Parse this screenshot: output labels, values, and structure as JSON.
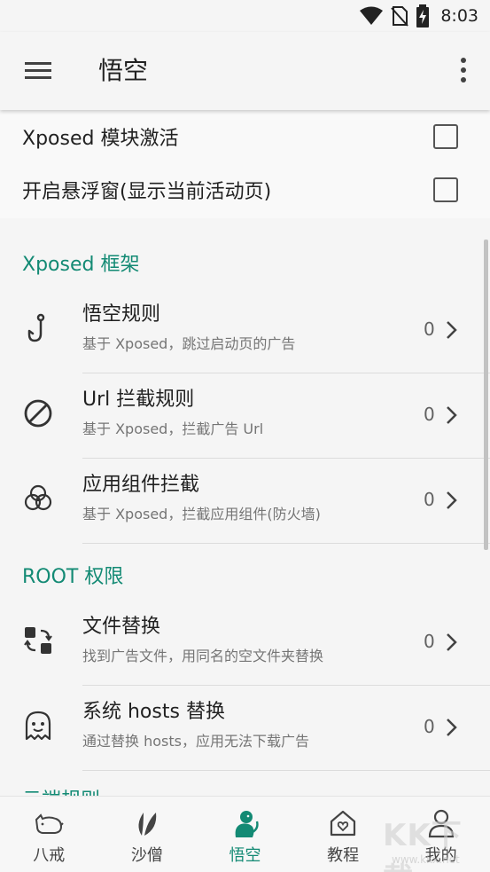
{
  "status_bar": {
    "time": "8:03"
  },
  "app_bar": {
    "title": "悟空"
  },
  "settings": [
    {
      "label": "Xposed 模块激活",
      "checked": false
    },
    {
      "label": "开启悬浮窗(显示当前活动页)",
      "checked": false
    }
  ],
  "sections": [
    {
      "header": "Xposed 框架",
      "items": [
        {
          "title": "悟空规则",
          "subtitle": "基于 Xposed，跳过启动页的广告",
          "count": "0",
          "icon": "hook-icon"
        },
        {
          "title": "Url 拦截规则",
          "subtitle": "基于 Xposed，拦截广告 Url",
          "count": "0",
          "icon": "block-icon"
        },
        {
          "title": "应用组件拦截",
          "subtitle": "基于 Xposed，拦截应用组件(防火墙)",
          "count": "0",
          "icon": "components-icon"
        }
      ]
    },
    {
      "header": "ROOT 权限",
      "items": [
        {
          "title": "文件替换",
          "subtitle": "找到广告文件，用同名的空文件夹替换",
          "count": "0",
          "icon": "file-swap-icon"
        },
        {
          "title": "系统 hosts 替换",
          "subtitle": "通过替换 hosts，应用无法下载广告",
          "count": "0",
          "icon": "ghost-icon"
        }
      ]
    },
    {
      "header": "云端规则"
    }
  ],
  "bottom_nav": [
    {
      "label": "八戒",
      "icon": "pig-icon",
      "active": false
    },
    {
      "label": "沙僧",
      "icon": "leaf-icon",
      "active": false
    },
    {
      "label": "悟空",
      "icon": "monkey-icon",
      "active": true
    },
    {
      "label": "教程",
      "icon": "home-heart-icon",
      "active": false
    },
    {
      "label": "我的",
      "icon": "person-icon",
      "active": false
    }
  ],
  "watermark": {
    "text": "KK下载",
    "url": "www.kkx.net"
  },
  "colors": {
    "accent": "#138a74",
    "background": "#f5f5f5",
    "text_primary": "#212121",
    "text_secondary": "#757575"
  }
}
